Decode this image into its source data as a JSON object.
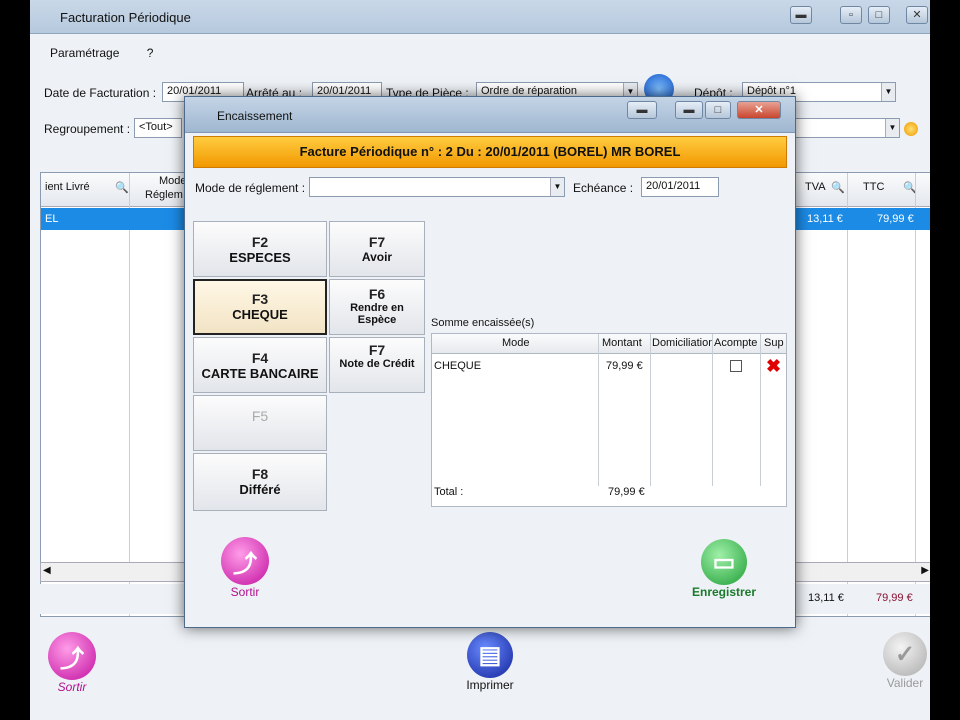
{
  "main_window": {
    "title": "Facturation Périodique",
    "menu": [
      "Paramétrage",
      "?"
    ],
    "date_label": "Date de Facturation :",
    "date_value": "20/01/2011",
    "arrete_label": "Arrêté au :",
    "arrete_value": "20/01/2011",
    "type_label": "Type de Pièce :",
    "type_value": "Ordre de réparation",
    "depot_label": "Dépôt :",
    "depot_value": "Dépôt n°1",
    "regroupement_label": "Regroupement :",
    "regroupement_value": "<Tout>",
    "columns": {
      "client": "ient Livré",
      "mode": "Mode",
      "mode2": "Réglem",
      "tva": "TVA",
      "ttc": "TTC"
    },
    "row": {
      "client": "EL",
      "tva": "13,11 €",
      "ttc": "79,99 €"
    },
    "totals": {
      "tva": "13,11 €",
      "ttc": "79,99 €"
    },
    "buttons": {
      "sortir": "Sortir",
      "imprimer": "Imprimer",
      "valider": "Valider"
    }
  },
  "dialog": {
    "title": "Encaissement",
    "banner": "Facture Périodique n° :  2 Du : 20/01/2011 (BOREL) MR BOREL",
    "mode_label": "Mode de réglement :",
    "mode_value": "",
    "echeance_label": "Echéance :",
    "echeance_value": "20/01/2011",
    "payment_buttons": [
      {
        "key": "F2",
        "label": "ESPECES"
      },
      {
        "key": "F3",
        "label": "CHEQUE"
      },
      {
        "key": "F4",
        "label": "CARTE BANCAIRE"
      },
      {
        "key": "F5",
        "label": ""
      },
      {
        "key": "F8",
        "label": "Différé"
      },
      {
        "key": "F7",
        "label": "Avoir"
      },
      {
        "key": "F6",
        "label": "Rendre en Espèce"
      },
      {
        "key": "F7",
        "label": "Note de Crédit"
      }
    ],
    "somme_label": "Somme encaissée(s)",
    "table_headers": [
      "Mode",
      "Montant",
      "Domiciliation",
      "Acompte",
      "Sup"
    ],
    "table_row": {
      "mode": "CHEQUE",
      "montant": "79,99 €",
      "domiciliation": "",
      "acompte": false
    },
    "total_label": "Total :",
    "total_value": "79,99 €",
    "sortir_label": "Sortir",
    "enregistrer_label": "Enregistrer"
  },
  "colors": {
    "banner": "#f29800",
    "selection": "#1c8be6",
    "sortir": "#d11fb4",
    "enregistrer": "#2fb04a",
    "imprimer": "#1f3fbf"
  }
}
